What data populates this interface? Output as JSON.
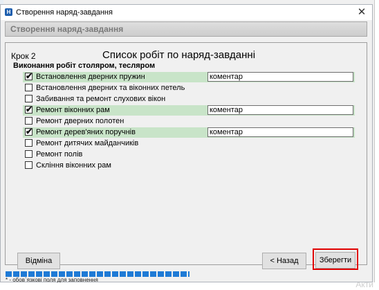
{
  "window": {
    "title": "Створення наряд-завдання",
    "app_icon": "H"
  },
  "header": {
    "title": "Створення наряд-завдання"
  },
  "step": {
    "label": "Крок 2",
    "title": "Список робіт по наряд-завданні"
  },
  "group": {
    "label": "Виконання робіт столяром, тесляром"
  },
  "tasks": [
    {
      "label": "Встановлення дверних пружин",
      "checked": true,
      "comment": "коментар"
    },
    {
      "label": "Встановлення дверних та віконних петель",
      "checked": false
    },
    {
      "label": "Забивання та ремонт слухових вікон",
      "checked": false
    },
    {
      "label": "Ремонт віконних рам",
      "checked": true,
      "comment": "коментар"
    },
    {
      "label": "Ремонт дверних полотен",
      "checked": false
    },
    {
      "label": "Ремонт дерев'яних поручнів",
      "checked": true,
      "comment": "коментар"
    },
    {
      "label": "Ремонт дитячих майданчиків",
      "checked": false
    },
    {
      "label": "Ремонт полів",
      "checked": false
    },
    {
      "label": "Скління віконних рам",
      "checked": false
    }
  ],
  "buttons": {
    "cancel": "Відміна",
    "back": "< Назад",
    "save": "Зберегти"
  },
  "footer": {
    "note": "* - обов`язкові поля для заповнення",
    "watermark": "Акти"
  },
  "colors": {
    "checked_row": "#c8e4c8",
    "progress": "#1e7ad6",
    "highlight_frame": "#e00000"
  },
  "icons": {
    "close": "close-icon",
    "check": "check-icon"
  }
}
